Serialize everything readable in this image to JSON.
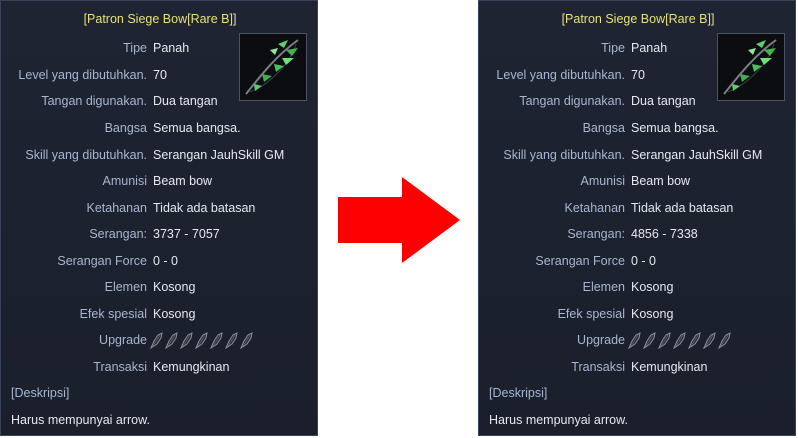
{
  "left": {
    "title": "[Patron Siege Bow[Rare B]]",
    "rows": [
      {
        "label": "Tipe",
        "value": "Panah"
      },
      {
        "label": "Level yang dibutuhkan.",
        "value": "70"
      },
      {
        "label": "Tangan digunakan.",
        "value": "Dua tangan"
      },
      {
        "label": "Bangsa",
        "value": "Semua bangsa."
      },
      {
        "label": "Skill yang dibutuhkan.",
        "value": "Serangan JauhSkill GM"
      },
      {
        "label": "Amunisi",
        "value": "Beam bow"
      },
      {
        "label": "Ketahanan",
        "value": "Tidak ada batasan"
      },
      {
        "label": "Serangan:",
        "value": "3737 - 7057"
      },
      {
        "label": "Serangan Force",
        "value": "0 - 0"
      },
      {
        "label": "Elemen",
        "value": "Kosong"
      },
      {
        "label": "Efek spesial",
        "value": "Kosong"
      },
      {
        "label": "Upgrade",
        "value": ""
      },
      {
        "label": "Transaksi",
        "value": "Kemungkinan"
      }
    ],
    "upgrade_slots": 7,
    "description_heading": "[Deskripsi]",
    "description": "Harus mempunyai arrow."
  },
  "right": {
    "title": "[Patron Siege Bow[Rare B]]",
    "rows": [
      {
        "label": "Tipe",
        "value": "Panah"
      },
      {
        "label": "Level yang dibutuhkan.",
        "value": "70"
      },
      {
        "label": "Tangan digunakan.",
        "value": "Dua tangan"
      },
      {
        "label": "Bangsa",
        "value": "Semua bangsa."
      },
      {
        "label": "Skill yang dibutuhkan.",
        "value": "Serangan JauhSkill GM"
      },
      {
        "label": "Amunisi",
        "value": "Beam bow"
      },
      {
        "label": "Ketahanan",
        "value": "Tidak ada batasan"
      },
      {
        "label": "Serangan:",
        "value": "4856 - 7338"
      },
      {
        "label": "Serangan Force",
        "value": "0 - 0"
      },
      {
        "label": "Elemen",
        "value": "Kosong"
      },
      {
        "label": "Efek spesial",
        "value": "Kosong"
      },
      {
        "label": "Upgrade",
        "value": ""
      },
      {
        "label": "Transaksi",
        "value": "Kemungkinan"
      }
    ],
    "upgrade_slots": 7,
    "description_heading": "[Deskripsi]",
    "description": "Harus mempunyai arrow."
  },
  "icons": {
    "item": "bow-icon",
    "arrow": "right-arrow-icon",
    "upgrade_slot": "upgrade-slot-icon"
  },
  "colors": {
    "title": "#e8e07a",
    "label": "#a8b6d2",
    "value": "#e6e9ee",
    "panel_bg": "#1e2432",
    "arrow": "#ff0000"
  }
}
